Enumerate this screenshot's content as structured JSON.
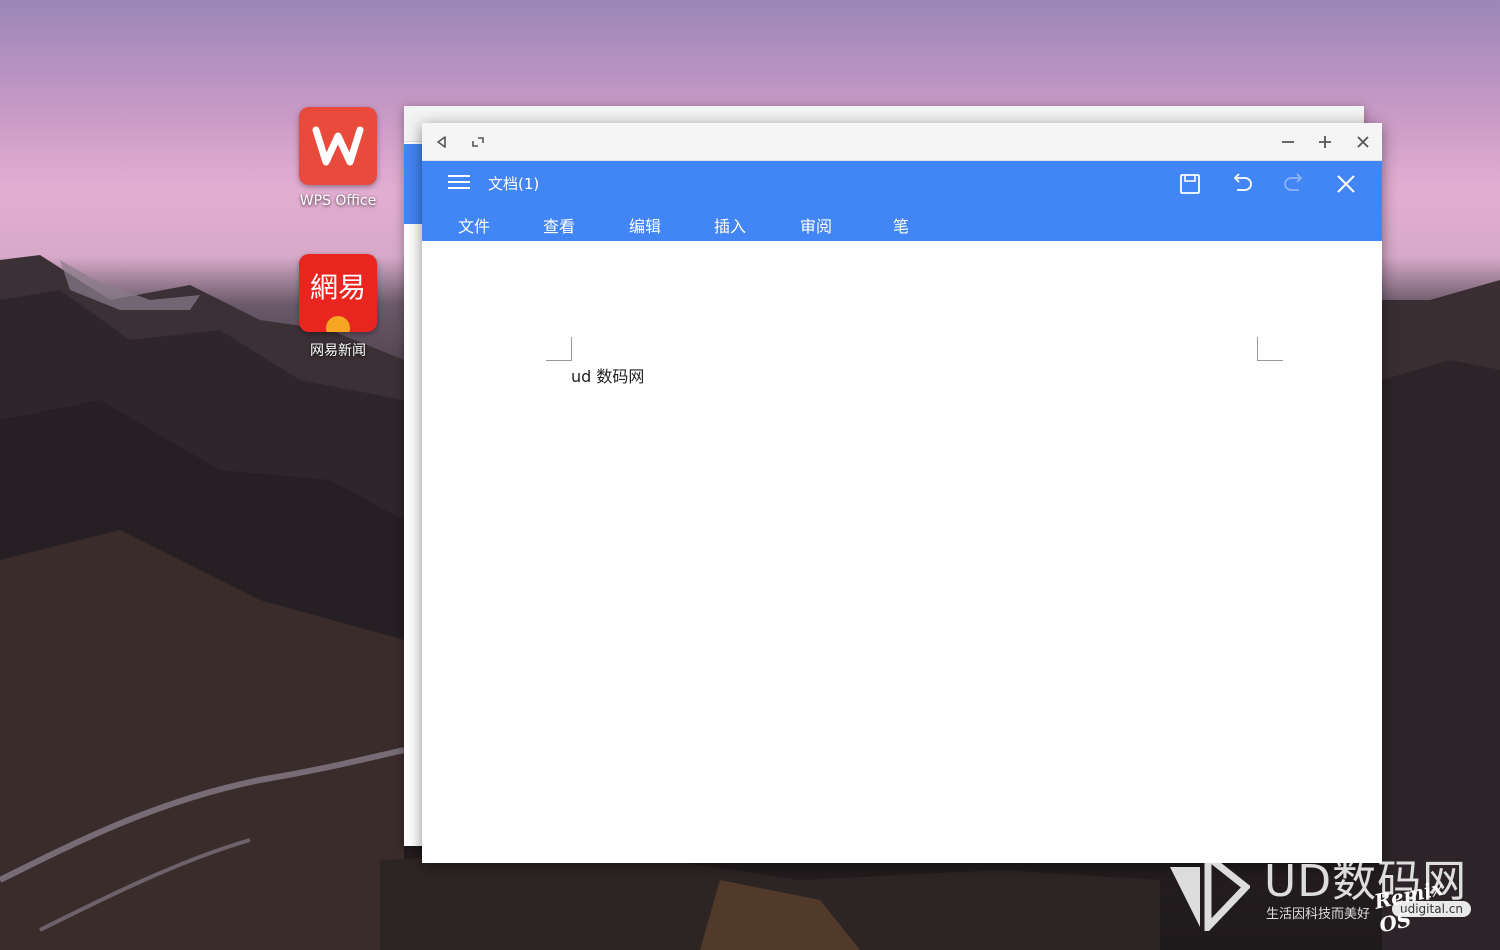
{
  "desktop": {
    "icons": [
      {
        "label": "WPS Office",
        "glyph": "W",
        "color": "#e84a3c"
      },
      {
        "label": "网易新闻",
        "glyph": "網易",
        "color": "#e8251f"
      }
    ]
  },
  "window": {
    "titlebar": {
      "back_icon": "back-triangle-icon",
      "expand_icon": "expand-icon",
      "minimize_icon": "minimize-icon",
      "maximize_icon": "plus-icon",
      "close_icon": "close-icon"
    },
    "appbar": {
      "doc_title": "文档(1)",
      "color": "#4285f4",
      "tabs": [
        {
          "label": "文件"
        },
        {
          "label": "查看"
        },
        {
          "label": "编辑"
        },
        {
          "label": "插入"
        },
        {
          "label": "审阅"
        },
        {
          "label": "笔"
        }
      ]
    },
    "document": {
      "text": "ud 数码网"
    }
  },
  "watermark": {
    "brand": "UD数码网",
    "slogan": "生活因科技而美好",
    "domain": "udigital.cn",
    "sub_brand": "Remix OS"
  }
}
